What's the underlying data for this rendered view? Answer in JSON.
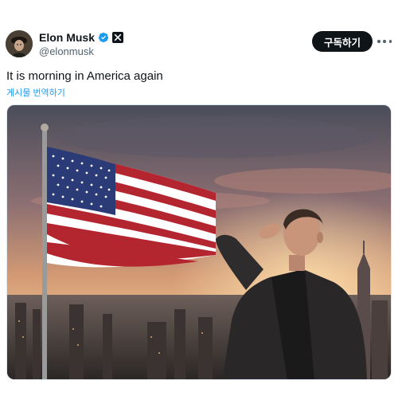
{
  "post": {
    "author": {
      "display_name": "Elon Musk",
      "handle": "@elonmusk",
      "verified": true
    },
    "subscribe_label": "구독하기",
    "text": "It is morning in America again",
    "translate_label": "게시물 번역하기",
    "media": {
      "kind": "photo"
    }
  },
  "icons": [
    "avatar",
    "verified-badge-icon",
    "x-badge-icon",
    "more-icon"
  ],
  "colors": {
    "button_bg": "#0f1419",
    "link": "#1d9bf0",
    "verified": "#1d9bf0",
    "secondary_text": "#536471"
  }
}
